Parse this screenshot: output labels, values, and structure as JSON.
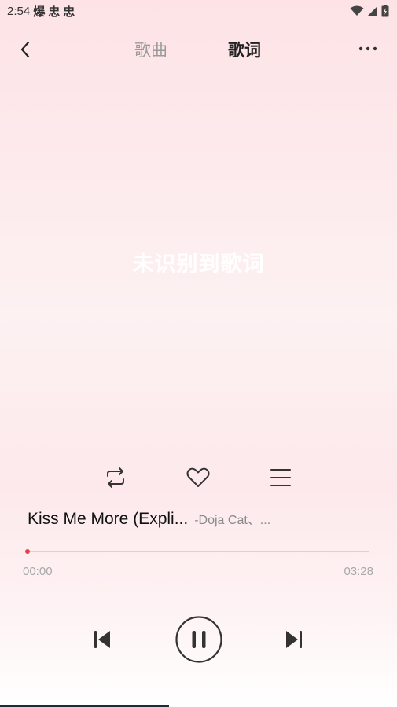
{
  "status_bar": {
    "time": "2:54",
    "notifications": [
      "爆",
      "忠",
      "忠"
    ],
    "icons": [
      "wifi-icon",
      "signal-icon",
      "battery-icon"
    ]
  },
  "header": {
    "back_icon": "chevron-left-icon",
    "tabs": [
      {
        "label": "歌曲",
        "active": false
      },
      {
        "label": "歌词",
        "active": true
      }
    ],
    "more_icon": "more-horizontal-icon"
  },
  "lyrics": {
    "empty_message": "未识别到歌词"
  },
  "actions": {
    "repeat_icon": "repeat-icon",
    "like_icon": "heart-icon",
    "playlist_icon": "list-icon"
  },
  "track": {
    "title": "Kiss Me More (Expli...",
    "artist": "-Doja Cat、..."
  },
  "playback": {
    "current_time": "00:00",
    "total_time": "03:28",
    "progress": 0.0
  },
  "controls": {
    "prev_icon": "skip-previous-icon",
    "play_pause_icon": "pause-icon",
    "next_icon": "skip-next-icon"
  },
  "colors": {
    "accent": "#e0454f",
    "background_top": "#fde3e6",
    "icon": "#333333"
  }
}
